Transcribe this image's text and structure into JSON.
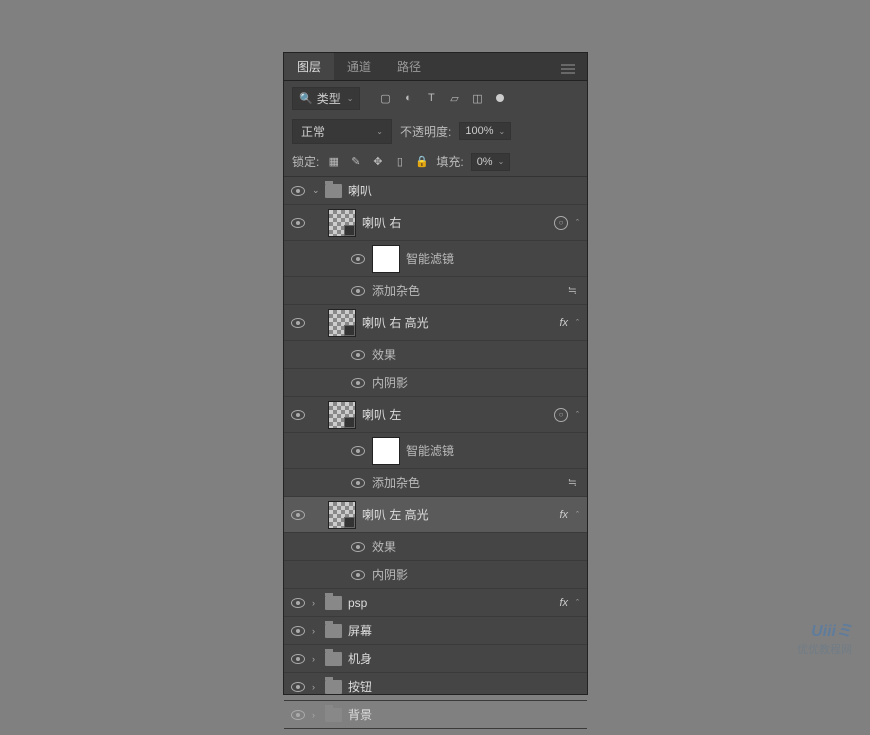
{
  "tabs": {
    "layers": "图层",
    "channels": "通道",
    "paths": "路径"
  },
  "filter": {
    "type_label": "类型"
  },
  "blend": {
    "mode": "正常",
    "opacity_label": "不透明度:",
    "opacity_value": "100%"
  },
  "lock": {
    "label": "锁定:",
    "fill_label": "填充:",
    "fill_value": "0%"
  },
  "layers": {
    "group_name": "喇叭",
    "speaker_right": "喇叭 右",
    "smart_filters": "智能滤镜",
    "add_noise": "添加杂色",
    "speaker_right_hl": "喇叭 右 高光",
    "effects": "效果",
    "inner_shadow": "内阴影",
    "speaker_left": "喇叭 左",
    "speaker_left_hl": "喇叭 左 高光",
    "psp": "psp",
    "screen": "屏幕",
    "body": "机身",
    "buttons": "按钮",
    "background": "背景"
  },
  "fx_label": "fx",
  "watermark": {
    "top": "Uiiiミ",
    "bottom": "优优教程网"
  }
}
